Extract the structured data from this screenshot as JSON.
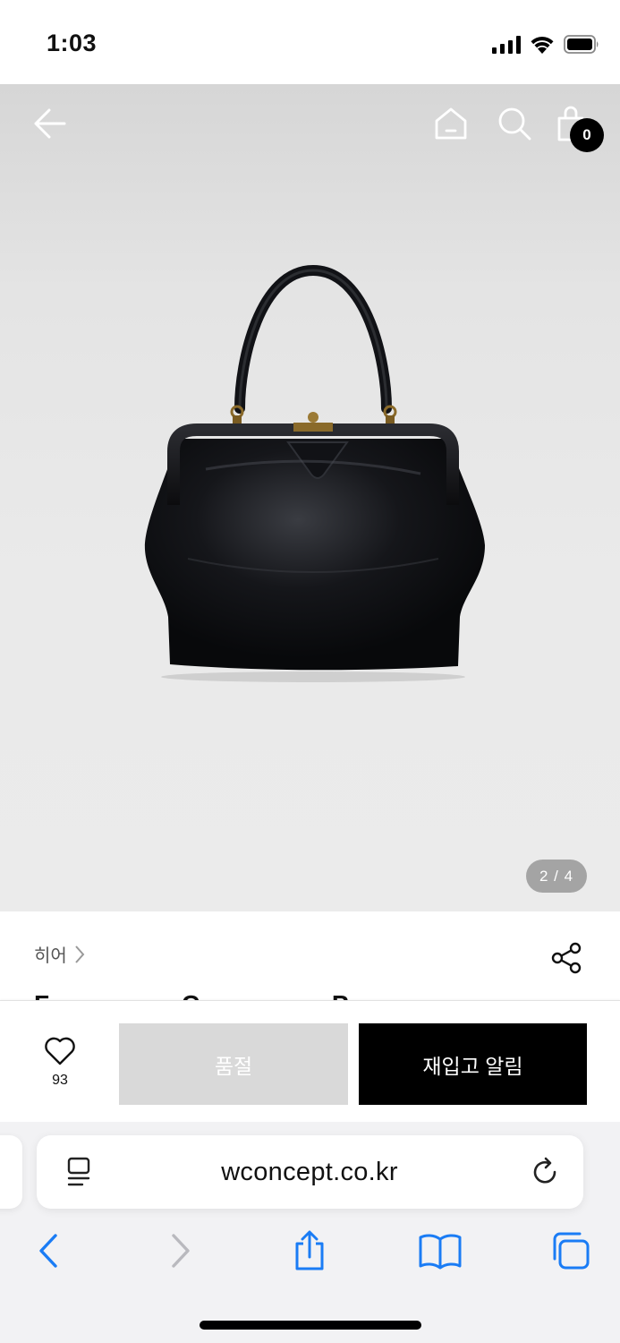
{
  "status_bar": {
    "time": "1:03",
    "icons": [
      "cellular-signal-icon",
      "wifi-icon",
      "battery-icon"
    ]
  },
  "header": {
    "icons": [
      "back-arrow-icon",
      "home-icon",
      "search-icon",
      "shopping-bag-icon"
    ],
    "cart_count": "0"
  },
  "gallery": {
    "page_indicator": "2 / 4",
    "current_page": 2,
    "total_pages": 4
  },
  "product": {
    "brand_label": "히어",
    "title_peek": "F C P"
  },
  "actions": {
    "like_count": "93",
    "soldout_label": "품절",
    "restock_label": "재입고 알림"
  },
  "browser": {
    "url": "wconcept.co.kr",
    "toolbar_icons": [
      "back-icon",
      "forward-icon",
      "share-icon",
      "bookmarks-icon",
      "tabs-icon"
    ]
  },
  "colors": {
    "accent_button": "#000000",
    "disabled_button": "#d9d9d9",
    "safari_blue": "#1a7cf5",
    "badge": "#000000"
  }
}
